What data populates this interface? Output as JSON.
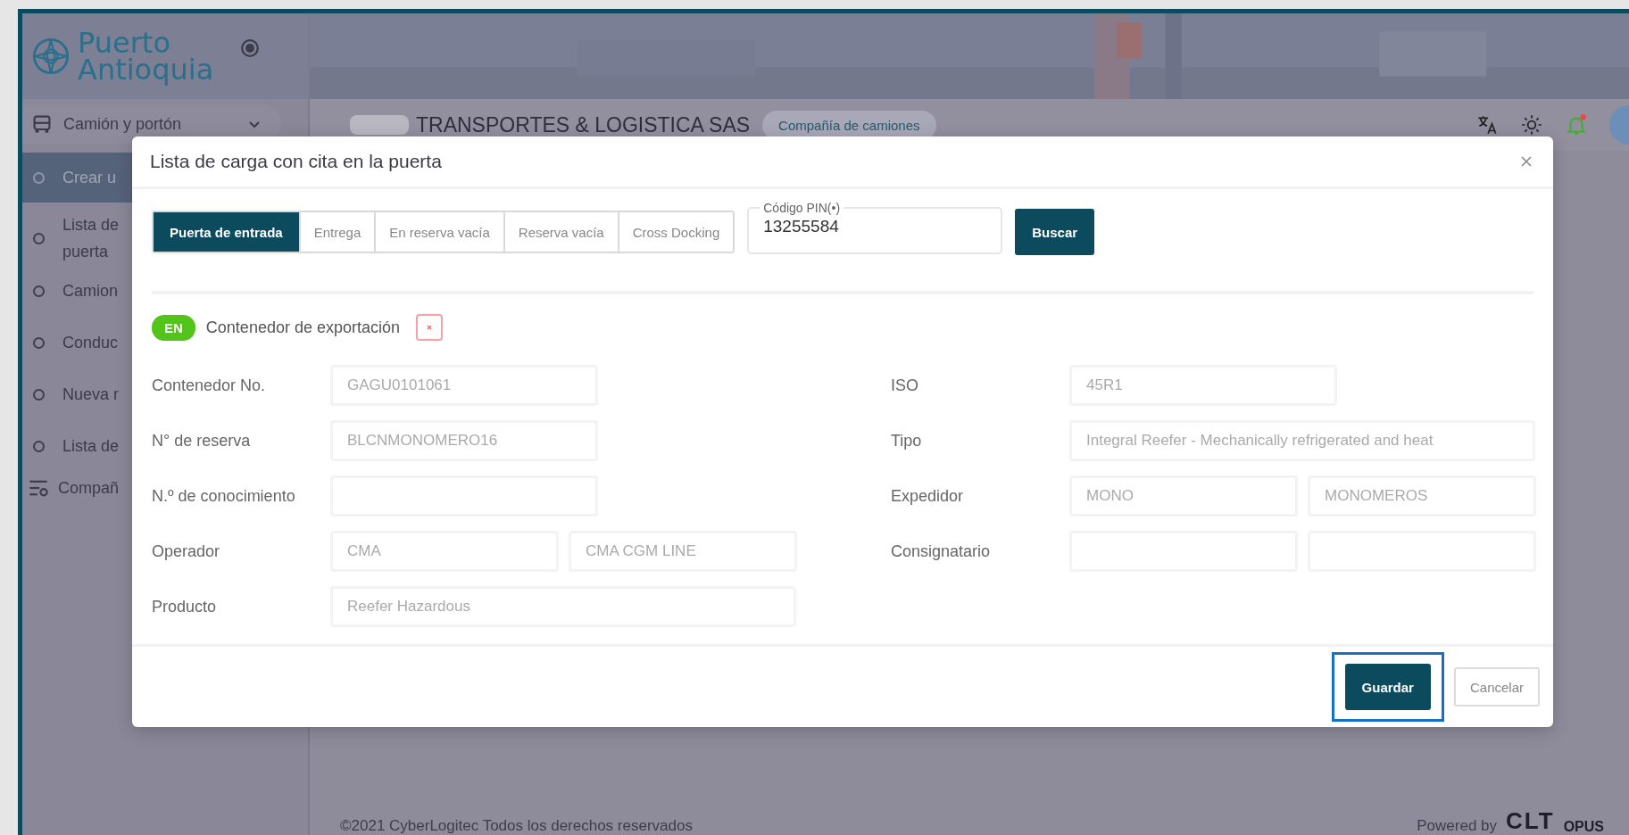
{
  "logo": {
    "line1": "Puerto",
    "line2": "Antioquia"
  },
  "sidebar": {
    "group": {
      "label": "Camión y portón",
      "expanded": true
    },
    "items": [
      {
        "lines": [
          "Crear u"
        ],
        "selected": true
      },
      {
        "lines": [
          "Lista de",
          "puerta"
        ],
        "selected": false
      },
      {
        "lines": [
          "Camion"
        ],
        "selected": false
      },
      {
        "lines": [
          "Conduc"
        ],
        "selected": false
      },
      {
        "lines": [
          "Nueva r"
        ],
        "selected": false
      },
      {
        "lines": [
          "Lista de"
        ],
        "selected": false
      }
    ],
    "section": {
      "label": "Compañ"
    }
  },
  "header": {
    "company": "TRANSPORTES & LOGISTICA SAS",
    "badge": "Compañía de camiones",
    "notification": true
  },
  "modal": {
    "title": "Lista de carga con cita en la puerta",
    "tabs": [
      {
        "label": "Puerta de entrada",
        "selected": true
      },
      {
        "label": "Entrega",
        "selected": false
      },
      {
        "label": "En reserva vacía",
        "selected": false
      },
      {
        "label": "Reserva vacía",
        "selected": false
      },
      {
        "label": "Cross Docking",
        "selected": false
      }
    ],
    "pin": {
      "label": "Código PIN(•)",
      "value": "13255584"
    },
    "search_button": "Buscar",
    "container_type": {
      "badge": "EN",
      "label": "Contenedor de exportación",
      "removable": true
    },
    "left_fields": [
      {
        "label": "Contenedor No.",
        "kind": "single",
        "disabled": true,
        "values": [
          "GAGU0101061"
        ]
      },
      {
        "label": "N° de reserva",
        "kind": "single",
        "disabled": true,
        "values": [
          "BLCNMONOMERO16"
        ]
      },
      {
        "label": "N.º de conocimiento",
        "kind": "single"
      },
      {
        "label": "Operador",
        "kind": "pair",
        "disabled": true,
        "values": [
          "CMA",
          "CMA CGM LINE"
        ]
      },
      {
        "label": "Producto",
        "kind": "wide",
        "disabled": true,
        "values": [
          "Reefer Hazardous"
        ]
      }
    ],
    "right_fields": [
      {
        "label": "ISO",
        "kind": "single",
        "disabled": true,
        "values": [
          "45R1"
        ]
      },
      {
        "label": "Tipo",
        "kind": "wide",
        "disabled": true,
        "values": [
          "Integral Reefer - Mechanically refrigerated and heat"
        ]
      },
      {
        "label": "Expedidor",
        "kind": "pair",
        "disabled": true,
        "values": [
          "MONO",
          "MONOMEROS"
        ]
      },
      {
        "label": "Consignatario",
        "kind": "pair"
      }
    ],
    "buttons": [
      {
        "label": "Guardar",
        "kind": "primary",
        "focused": true
      },
      {
        "label": "Cancelar",
        "kind": "secondary",
        "focused": false
      }
    ]
  },
  "footer": {
    "copyright": "©2021 CyberLogitec Todos los derechos reservados",
    "powered_by": "Powered by",
    "brand": "CLT",
    "product": "OPUS"
  }
}
